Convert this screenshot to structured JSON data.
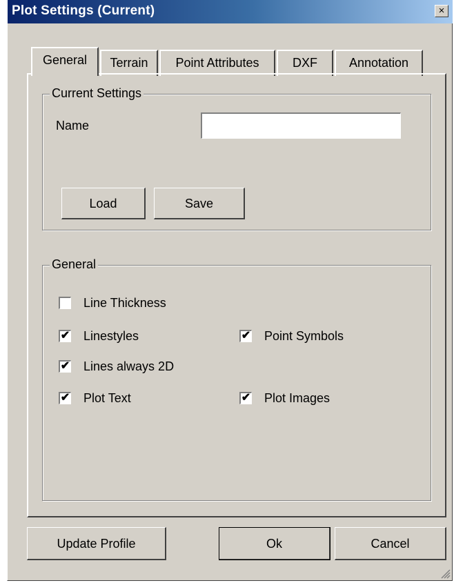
{
  "window": {
    "title": "Plot Settings  (Current)",
    "close_glyph": "×"
  },
  "tabs": [
    {
      "label": "General",
      "active": true
    },
    {
      "label": "Terrain",
      "active": false
    },
    {
      "label": "Point Attributes",
      "active": false
    },
    {
      "label": "DXF",
      "active": false
    },
    {
      "label": "Annotation",
      "active": false
    }
  ],
  "current_settings": {
    "group_label": "Current Settings",
    "name_label": "Name",
    "name_value": "",
    "load_label": "Load",
    "save_label": "Save"
  },
  "general": {
    "group_label": "General",
    "options": [
      {
        "label": "Line Thickness",
        "checked": false
      },
      {
        "label": "Linestyles",
        "checked": true
      },
      {
        "label": "Point Symbols",
        "checked": true
      },
      {
        "label": "Lines always 2D",
        "checked": true
      },
      {
        "label": "Plot Text",
        "checked": true
      },
      {
        "label": "Plot Images",
        "checked": true
      }
    ],
    "check_glyph": "✔"
  },
  "footer": {
    "update_profile_label": "Update Profile",
    "ok_label": "Ok",
    "cancel_label": "Cancel"
  },
  "colors": {
    "title_bar_start": "#0a246a",
    "title_bar_end": "#a6caf0",
    "face": "#d4d0c8"
  }
}
